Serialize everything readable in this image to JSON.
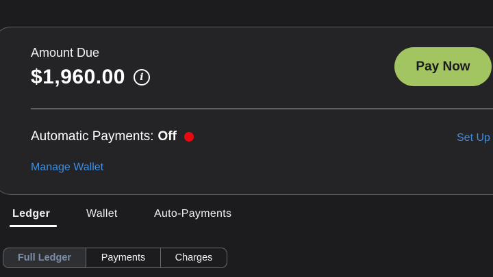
{
  "billing": {
    "amount_label": "Amount Due",
    "amount_value": "$1,960.00",
    "info_icon": "i",
    "pay_button": "Pay Now",
    "auto_label": "Automatic Payments:",
    "auto_status": "Off",
    "setup_link": "Set Up",
    "wallet_link": "Manage Wallet"
  },
  "tabs": [
    {
      "label": "Ledger",
      "active": true
    },
    {
      "label": "Wallet",
      "active": false
    },
    {
      "label": "Auto-Payments",
      "active": false
    }
  ],
  "segments": [
    {
      "label": "Full Ledger",
      "active": true
    },
    {
      "label": "Payments",
      "active": false
    },
    {
      "label": "Charges",
      "active": false
    }
  ],
  "colors": {
    "background": "#1c1c1e",
    "card": "#242426",
    "accent_green": "#a3c561",
    "link_blue": "#3f8ee0",
    "status_off_red": "#e8090f"
  },
  "icons": {
    "info": "info-icon",
    "status": "status-dot-icon"
  }
}
